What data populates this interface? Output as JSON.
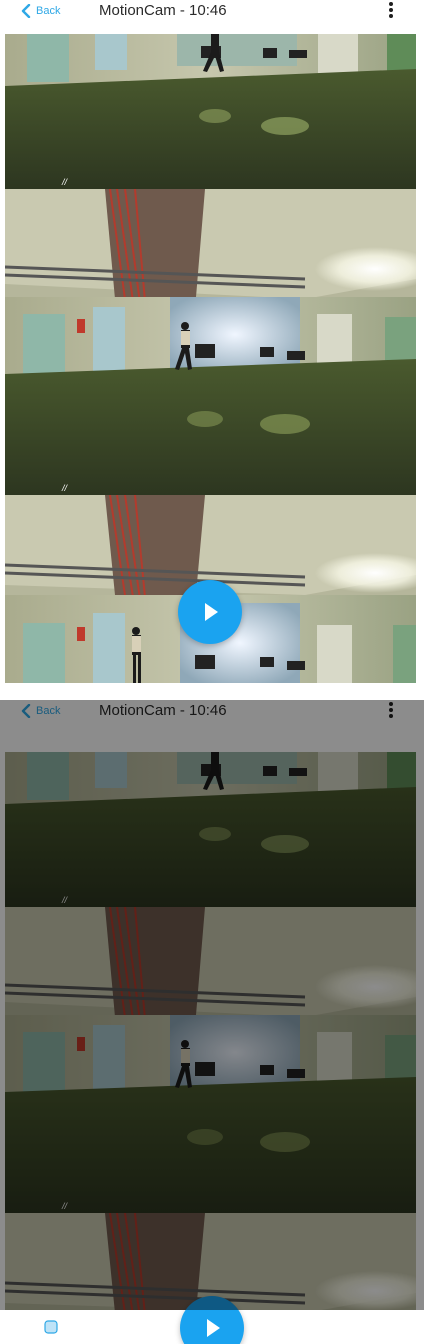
{
  "header": {
    "back_label": "Back",
    "title": "MotionCam - 10:46",
    "menu_icon": "more-vertical-icon"
  },
  "player": {
    "play_icon": "play-icon"
  },
  "colors": {
    "accent": "#1aa3f0",
    "back_text": "#2fa8e6",
    "dim_overlay": "rgba(0,0,0,0.45)"
  },
  "screens": [
    {
      "name": "normal-state"
    },
    {
      "name": "dimmed-state"
    }
  ]
}
